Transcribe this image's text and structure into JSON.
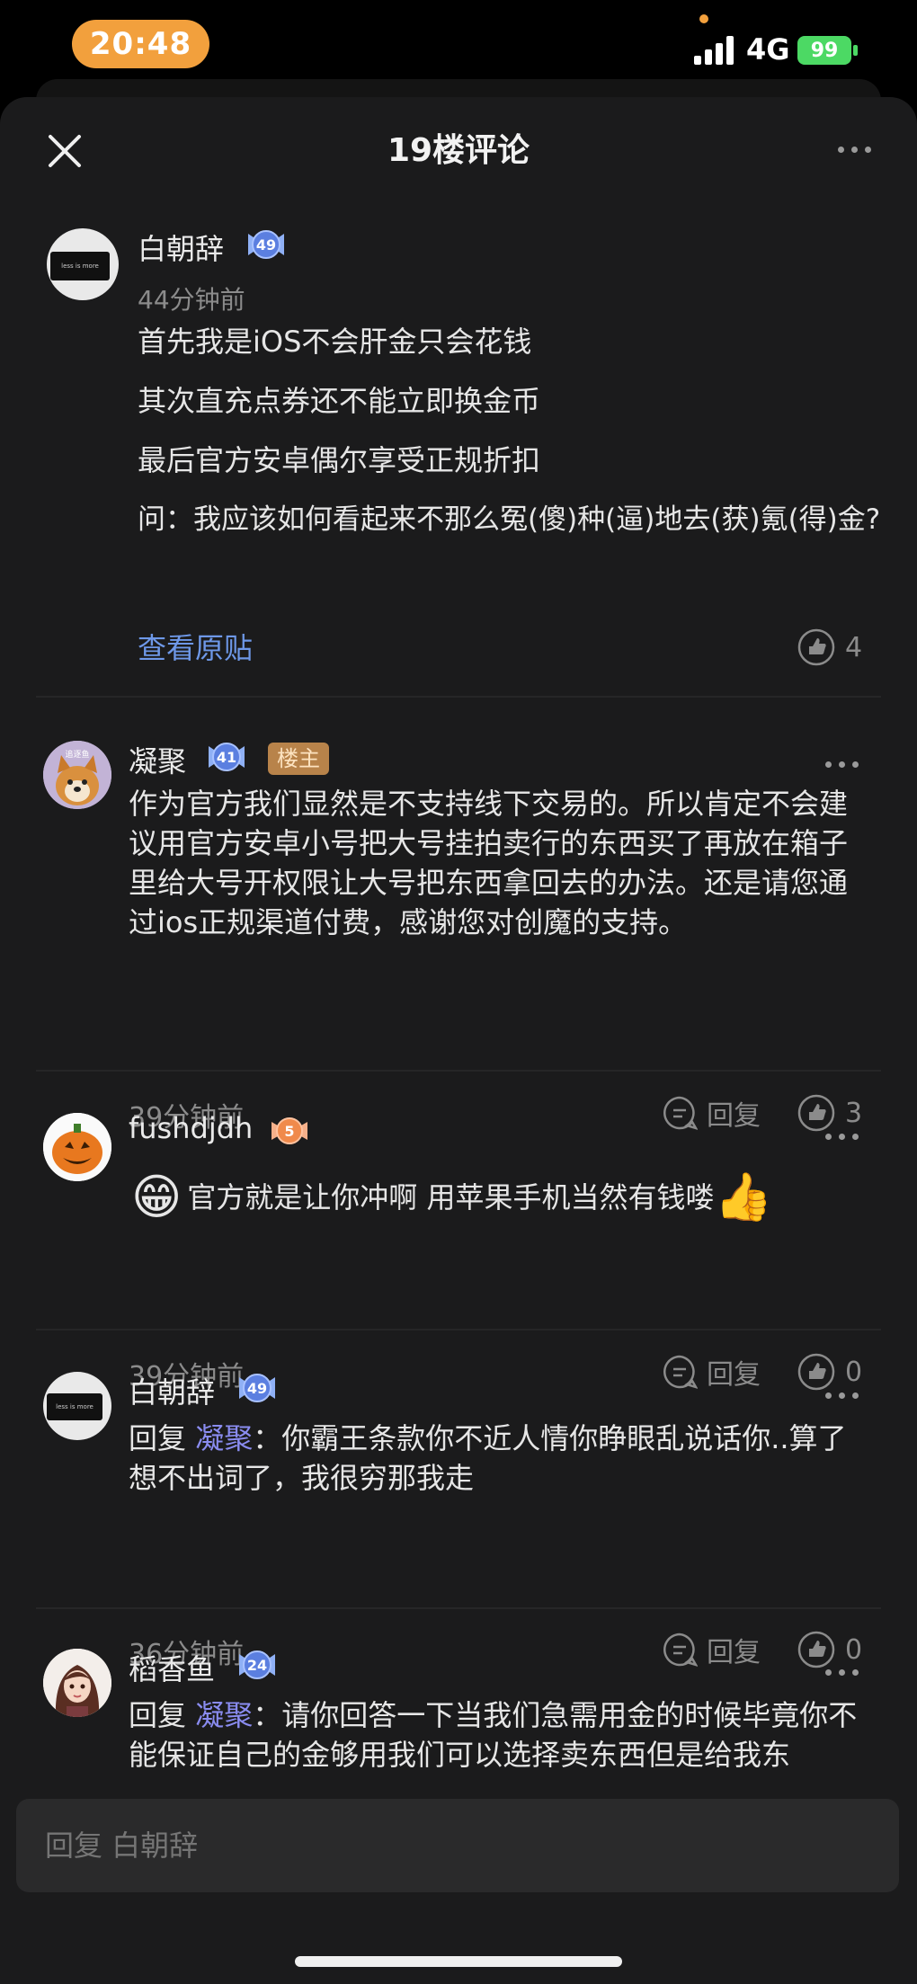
{
  "status_bar": {
    "time": "20:48",
    "network": "4G",
    "battery": "99"
  },
  "header": {
    "title": "19楼评论"
  },
  "main_comment": {
    "username": "白朝辞",
    "level": "49",
    "avatar_text": "less is more",
    "time": "44分钟前",
    "paragraphs": [
      "首先我是iOS不会肝金只会花钱",
      "其次直充点券还不能立即换金币",
      "最后官方安卓偶尔享受正规折扣",
      "问：我应该如何看起来不那么冤(傻)种(逼)地去(获)氪(得)金?"
    ],
    "view_original": "查看原贴",
    "likes": "4"
  },
  "replies": [
    {
      "username": "凝聚",
      "level": "41",
      "badge": "楼主",
      "avatar_text": "追逐鱼",
      "text": "作为官方我们显然是不支持线下交易的。所以肯定不会建议用官方安卓小号把大号挂拍卖行的东西买了再放在箱子里给大号开权限让大号把东西拿回去的办法。还是请您通过ios正规渠道付费，感谢您对创魔的支持。",
      "time": "39分钟前",
      "reply_label": "回复",
      "likes": "3"
    },
    {
      "username": "fushdjdh",
      "level": "5",
      "text": "官方就是让你冲啊 用苹果手机当然有钱喽",
      "emoji_start": "😁",
      "emoji_end": "👍",
      "time": "39分钟前",
      "reply_label": "回复",
      "likes": "0"
    },
    {
      "username": "白朝辞",
      "level": "49",
      "avatar_text": "less is more",
      "reply_prefix": "回复",
      "mention": "凝聚",
      "text": "：你霸王条款你不近人情你睁眼乱说话你..算了想不出词了，我很穷那我走",
      "time": "36分钟前",
      "reply_label": "回复",
      "likes": "0"
    },
    {
      "username": "稻香鱼",
      "level": "24",
      "reply_prefix": "回复",
      "mention": "凝聚",
      "text": "：请你回答一下当我们急需用金的时候毕竟你不能保证自己的金够用我们可以选择卖东西但是给我东"
    }
  ],
  "reply_input": {
    "placeholder": "回复 白朝辞"
  },
  "colors": {
    "accent_link": "#6e98e8",
    "mention": "#8a8cf0",
    "owner_badge": "#b8834a",
    "time_pill": "#f2a03d",
    "level_badge": "#5b7fe0",
    "level_badge_low": "#f08a4b"
  }
}
